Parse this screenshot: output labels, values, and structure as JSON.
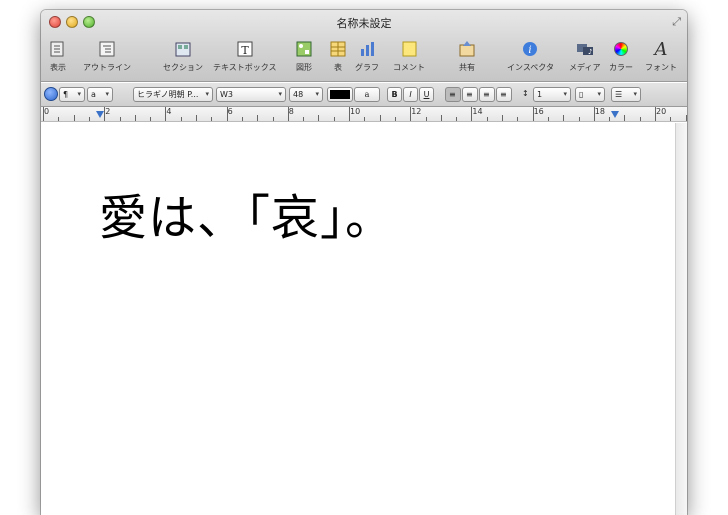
{
  "window": {
    "title": "名称未設定"
  },
  "toolbar": [
    {
      "name": "view-button",
      "label": "表示",
      "icon": "view-icon"
    },
    {
      "name": "outline-button",
      "label": "アウトライン",
      "icon": "outline-icon"
    },
    {
      "name": "section-button",
      "label": "セクション",
      "icon": "section-icon"
    },
    {
      "name": "textbox-button",
      "label": "テキストボックス",
      "icon": "textbox-icon"
    },
    {
      "name": "shape-button",
      "label": "図形",
      "icon": "shape-icon"
    },
    {
      "name": "table-button",
      "label": "表",
      "icon": "table-icon"
    },
    {
      "name": "graph-button",
      "label": "グラフ",
      "icon": "graph-icon"
    },
    {
      "name": "comment-button",
      "label": "コメント",
      "icon": "comment-icon"
    },
    {
      "name": "share-button",
      "label": "共有",
      "icon": "share-icon"
    },
    {
      "name": "inspector-button",
      "label": "インスペクタ",
      "icon": "inspector-icon"
    },
    {
      "name": "media-button",
      "label": "メディア",
      "icon": "media-icon"
    },
    {
      "name": "color-button",
      "label": "カラー",
      "icon": "color-wheel-icon"
    },
    {
      "name": "font-button",
      "label": "フォント",
      "icon": "font-icon"
    }
  ],
  "format": {
    "paragraph_mark": "¶",
    "char_style": "a",
    "font_name": "ヒラギノ明朝 P...",
    "font_weight": "W3",
    "font_size": "48",
    "bold": "B",
    "italic": "I",
    "underline": "U",
    "line_spacing": "1",
    "text_color": "#000000"
  },
  "ruler": {
    "labels": [
      "0",
      "2",
      "4",
      "6",
      "8",
      "10",
      "12",
      "14",
      "16",
      "18",
      "20"
    ]
  },
  "document": {
    "text": "愛は、「哀」。"
  }
}
